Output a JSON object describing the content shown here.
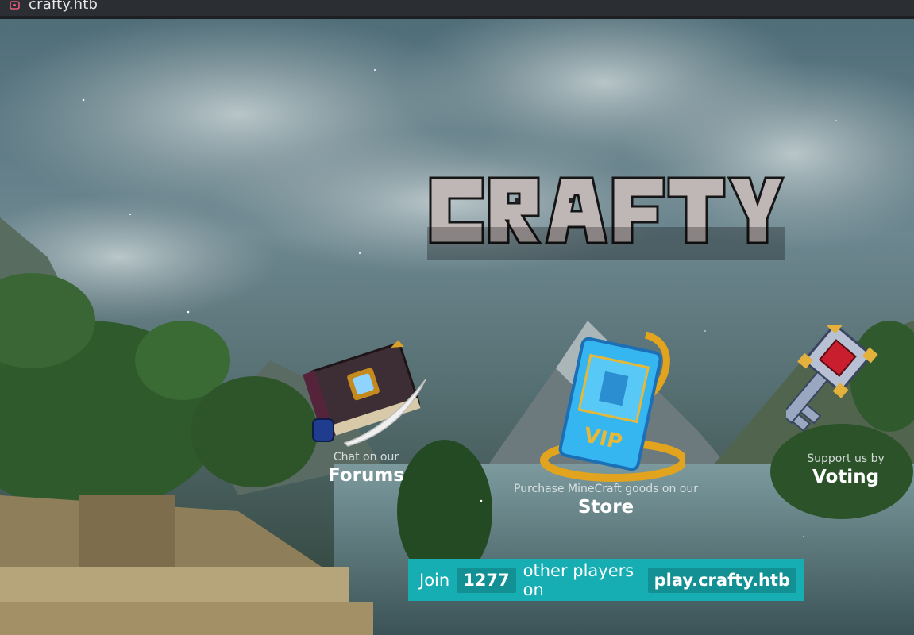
{
  "browser": {
    "tab_title": "crafty.htb"
  },
  "site": {
    "logo_text": "CRAFTY",
    "forums": {
      "sub": "Chat on our",
      "title": "Forums"
    },
    "store": {
      "sub": "Purchase MineCraft goods on our",
      "title": "Store"
    },
    "voting": {
      "sub": "Support us by",
      "title": "Voting"
    },
    "join": {
      "prefix": "Join",
      "count": "1277",
      "middle": "other players on",
      "address": "play.crafty.htb"
    }
  },
  "colors": {
    "banner": "#17aeb3",
    "banner_pill": "#139094"
  }
}
